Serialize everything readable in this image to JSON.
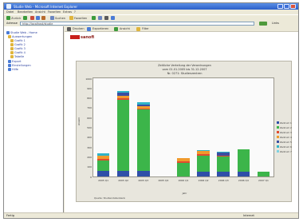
{
  "window": {
    "title": "Studie Web - Microsoft Internet Explorer"
  },
  "menubar": {
    "items": [
      "Datei",
      "Bearbeiten",
      "Ansicht",
      "Favoriten",
      "Extras",
      "?"
    ]
  },
  "toolbar": {
    "back_label": "Zurück",
    "search_label": "Suchen",
    "favorites_label": "Favoriten"
  },
  "address": {
    "label": "Adresse",
    "value": "http://localhost/studie",
    "links_label": "Links"
  },
  "sidebar": {
    "items": [
      {
        "label": "Studie Web - Home",
        "icon": "home-icon",
        "color": "#4a7bd6"
      },
      {
        "label": "Auswertungen",
        "icon": "folder-icon",
        "color": "#e0b53c"
      },
      {
        "label": "Grafik 1",
        "icon": "document-icon",
        "color": "#e0b53c"
      },
      {
        "label": "Grafik 2",
        "icon": "document-icon",
        "color": "#e0b53c"
      },
      {
        "label": "Grafik 3",
        "icon": "document-icon",
        "color": "#e0b53c"
      },
      {
        "label": "Grafik 4",
        "icon": "document-icon",
        "color": "#e0b53c"
      },
      {
        "label": "Tabelle",
        "icon": "document-icon",
        "color": "#e0b53c"
      },
      {
        "label": "Export",
        "icon": "document-icon",
        "color": "#4a7bd6"
      },
      {
        "label": "Einstellungen",
        "icon": "gear-icon",
        "color": "#4a7bd6"
      },
      {
        "label": "Hilfe",
        "icon": "help-icon",
        "color": "#4a7bd6"
      }
    ]
  },
  "content_toolbar": {
    "items": [
      "Drucken",
      "Exportieren",
      "Ansicht",
      "Filter"
    ]
  },
  "brand": {
    "name": "sanofi"
  },
  "chart_data": {
    "type": "bar",
    "title_lines": [
      "Zeitliche Verteilung der Verordnungen",
      "vom 01.01.2005 bis 31.12.2007",
      "Nr. 0271: Studienzentren"
    ],
    "xlabel": "Jahr",
    "ylabel": "Anzahl",
    "ylim": [
      0,
      1000
    ],
    "yticks": [
      0,
      100,
      200,
      300,
      400,
      500,
      600,
      700,
      800,
      900,
      1000
    ],
    "categories": [
      "2005 Q1",
      "2005 Q2",
      "2005 Q3",
      "2005 Q4",
      "2006 Q1",
      "2006 Q2",
      "2006 Q3",
      "2006 Q4",
      "2007 Q1"
    ],
    "series": [
      {
        "name": "Zentrum 1",
        "color": "#2f4fa8",
        "values": [
          60,
          60,
          60,
          0,
          0,
          50,
          50,
          50,
          0
        ]
      },
      {
        "name": "Zentrum 2",
        "color": "#3cb54a",
        "values": [
          100,
          720,
          620,
          0,
          140,
          160,
          150,
          230,
          50
        ]
      },
      {
        "name": "Zentrum 3",
        "color": "#e04b2e",
        "values": [
          15,
          20,
          15,
          0,
          15,
          20,
          15,
          0,
          0
        ]
      },
      {
        "name": "Zentrum 4",
        "color": "#f09a2c",
        "values": [
          40,
          20,
          20,
          0,
          30,
          30,
          0,
          0,
          0
        ]
      },
      {
        "name": "Zentrum 5",
        "color": "#3a4ea0",
        "values": [
          0,
          30,
          20,
          0,
          0,
          0,
          30,
          0,
          0
        ]
      },
      {
        "name": "Zentrum 6",
        "color": "#2fb4c8",
        "values": [
          20,
          20,
          20,
          0,
          0,
          10,
          10,
          0,
          0
        ]
      },
      {
        "name": "Zentrum 7",
        "color": "#7fd1e0",
        "values": [
          0,
          0,
          0,
          0,
          0,
          0,
          0,
          0,
          0
        ]
      }
    ],
    "legend_placement": "right",
    "grid": false
  },
  "footer_note": "Quelle: Studiendatenbank",
  "status": {
    "text": "Fertig",
    "zone": "Internet"
  }
}
